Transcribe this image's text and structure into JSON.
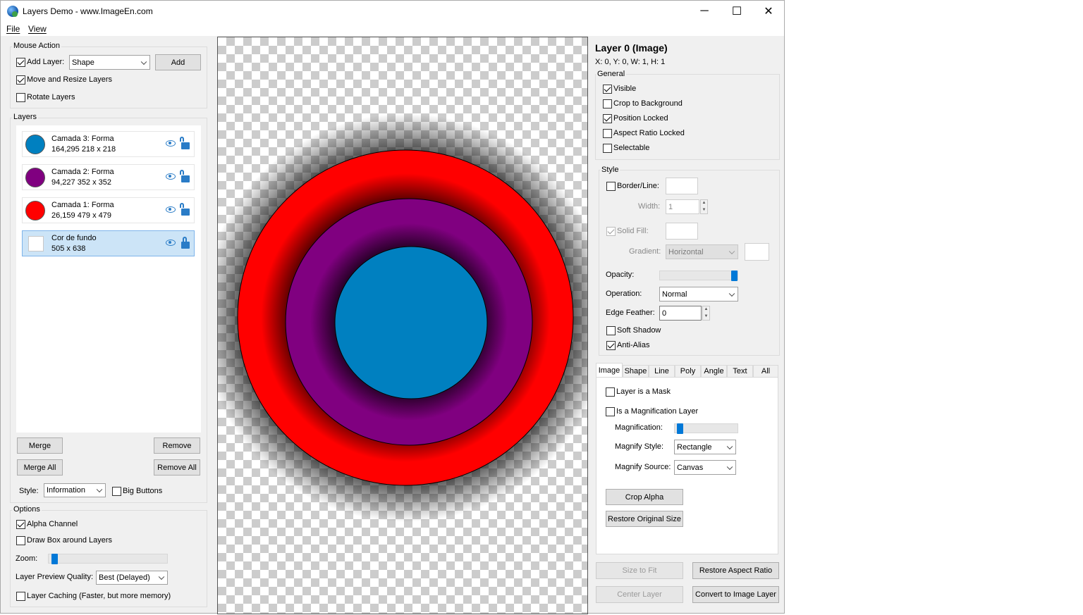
{
  "window": {
    "title": "Layers Demo  - www.ImageEn.com",
    "controls": {
      "minimize": "─",
      "maximize": "☐",
      "close": "✕"
    }
  },
  "menu": {
    "file": "File",
    "view": "View"
  },
  "mouse_action": {
    "group_title": "Mouse Action",
    "add_layer_label": "Add Layer:",
    "add_layer_checked": true,
    "layer_type_value": "Shape",
    "add_button": "Add",
    "move_resize_label": "Move and Resize Layers",
    "move_resize_checked": true,
    "rotate_label": "Rotate Layers",
    "rotate_checked": false
  },
  "layers": {
    "group_title": "Layers",
    "items": [
      {
        "name": "Camada 3: Forma",
        "info": "164,295  218 x 218",
        "color": "#0080c0",
        "locked": false,
        "selected": false
      },
      {
        "name": "Camada 2: Forma",
        "info": "94,227  352 x 352",
        "color": "#800080",
        "locked": false,
        "selected": false
      },
      {
        "name": "Camada 1: Forma",
        "info": "26,159  479 x 479",
        "color": "#ff0000",
        "locked": false,
        "selected": false
      },
      {
        "name": "Cor de fundo",
        "info": "505 x 638",
        "color": "#ffffff",
        "locked": true,
        "selected": true
      }
    ],
    "merge_button": "Merge",
    "remove_button": "Remove",
    "merge_all_button": "Merge All",
    "remove_all_button": "Remove All",
    "style_label": "Style:",
    "style_value": "Information",
    "big_buttons_label": "Big Buttons",
    "big_buttons_checked": false
  },
  "options": {
    "group_title": "Options",
    "alpha_channel_label": "Alpha Channel",
    "alpha_channel_checked": true,
    "draw_box_label": "Draw Box around Layers",
    "draw_box_checked": false,
    "zoom_label": "Zoom:",
    "zoom_level": 0.0,
    "preview_quality_label": "Layer Preview Quality:",
    "preview_quality_value": "Best (Delayed)",
    "caching_label": "Layer Caching (Faster, but more memory)",
    "caching_checked": false
  },
  "canvas": {
    "circles": [
      {
        "name": "layer-1-circle",
        "color": "#ff0000"
      },
      {
        "name": "layer-2-circle",
        "color": "#800080"
      },
      {
        "name": "layer-3-circle",
        "color": "#0080c0"
      }
    ]
  },
  "properties": {
    "heading": "Layer 0 (Image)",
    "coords": "X: 0, Y: 0, W: 1, H: 1",
    "general": {
      "title": "General",
      "visible": "Visible",
      "visible_checked": true,
      "crop_bg": "Crop to Background",
      "crop_bg_checked": false,
      "pos_locked": "Position Locked",
      "pos_locked_checked": true,
      "aspect_locked": "Aspect Ratio Locked",
      "aspect_locked_checked": false,
      "selectable": "Selectable",
      "selectable_checked": false
    },
    "style": {
      "title": "Style",
      "border_label": "Border/Line:",
      "width_label": "Width:",
      "width_value": "1",
      "solid_fill_label": "Solid Fill:",
      "gradient_label": "Gradient:",
      "gradient_value": "Horizontal",
      "opacity_label": "Opacity:",
      "opacity_level": 1.0,
      "operation_label": "Operation:",
      "operation_value": "Normal",
      "edge_feather_label": "Edge Feather:",
      "edge_feather_value": "0",
      "soft_shadow_label": "Soft Shadow",
      "anti_alias_label": "Anti-Alias"
    },
    "tabs": [
      "Image",
      "Shape",
      "Line",
      "Poly",
      "Angle",
      "Text",
      "All"
    ],
    "image_tab": {
      "mask_label": "Layer is a Mask",
      "magnification_layer_label": "Is a Magnification Layer",
      "magnification_label": "Magnification:",
      "magnification_level": 0.0,
      "magnify_style_label": "Magnify Style:",
      "magnify_style_value": "Rectangle",
      "magnify_source_label": "Magnify Source:",
      "magnify_source_value": "Canvas",
      "crop_alpha_button": "Crop Alpha",
      "restore_size_button": "Restore Original Size"
    },
    "size_to_fit_button": "Size to Fit",
    "restore_aspect_button": "Restore Aspect Ratio",
    "center_layer_button": "Center Layer",
    "convert_button": "Convert to Image Layer"
  }
}
